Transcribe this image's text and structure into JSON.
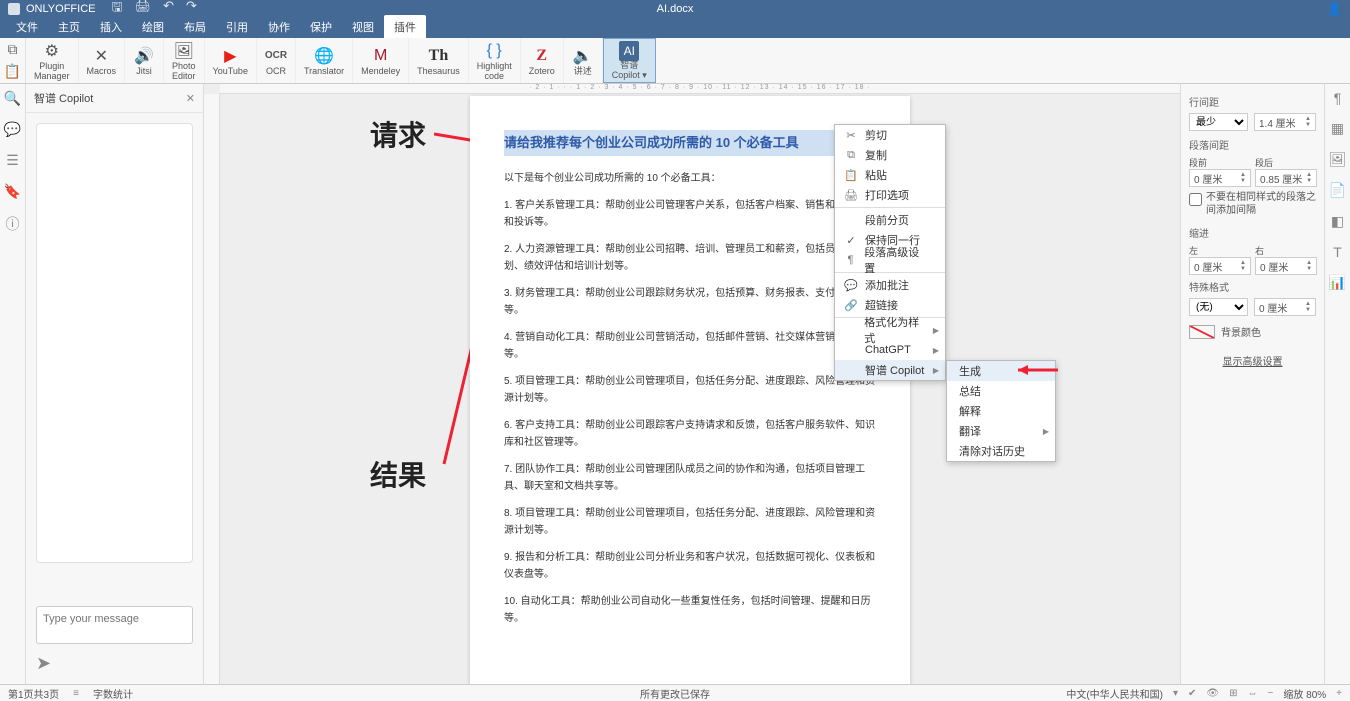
{
  "app": {
    "name": "ONLYOFFICE",
    "doc_name": "AI.docx"
  },
  "tabs": [
    "文件",
    "主页",
    "插入",
    "绘图",
    "布局",
    "引用",
    "协作",
    "保护",
    "视图",
    "插件"
  ],
  "active_tab_index": 9,
  "ribbon": [
    {
      "id": "plugin-manager",
      "label": "Plugin\nManager",
      "icon": "⚙"
    },
    {
      "id": "macros",
      "label": "Macros",
      "icon": "✕"
    },
    {
      "id": "jitsi",
      "label": "Jitsi",
      "icon": "🔊"
    },
    {
      "id": "photo-editor",
      "label": "Photo\nEditor",
      "icon": "🖼"
    },
    {
      "id": "youtube",
      "label": "YouTube",
      "icon": "▶",
      "cls": "youtube"
    },
    {
      "id": "ocr",
      "label": "OCR",
      "icon": "OCR",
      "cls": "ocr"
    },
    {
      "id": "translator",
      "label": "Translator",
      "icon": "🌐"
    },
    {
      "id": "mendeley",
      "label": "Mendeley",
      "icon": "M",
      "cls": "mendeley"
    },
    {
      "id": "thesaurus",
      "label": "Thesaurus",
      "icon": "Th",
      "cls": "thesaurus"
    },
    {
      "id": "highlight-code",
      "label": "Highlight\ncode",
      "icon": "{ }",
      "cls": "code"
    },
    {
      "id": "zotero",
      "label": "Zotero",
      "icon": "Z",
      "cls": "zotero"
    },
    {
      "id": "speech",
      "label": "讲述",
      "icon": "🔈"
    },
    {
      "id": "copilot",
      "label": "智谱\nCopilot ▾",
      "icon": "AI",
      "cls": "copilot",
      "highlighted": true
    }
  ],
  "side_panel": {
    "title": "智谱 Copilot",
    "input_placeholder": "Type your message"
  },
  "annotations": {
    "request": "请求",
    "result": "结果"
  },
  "document": {
    "request": "请给我推荐每个创业公司成功所需的 10 个必备工具",
    "intro": "以下是每个创业公司成功所需的 10 个必备工具：",
    "items": [
      "1. 客户关系管理工具：帮助创业公司管理客户关系，包括客户档案、销售和营销进度和投诉等。",
      "2. 人力资源管理工具：帮助创业公司招聘、培训、管理员工和薪资，包括员工档案计划、绩效评估和培训计划等。",
      "3. 财务管理工具：帮助创业公司跟踪财务状况，包括预算、财务报表、支付和收款等。",
      "4. 营销自动化工具：帮助创业公司营销活动，包括邮件营销、社交媒体营销、搜索告等。",
      "5. 项目管理工具：帮助创业公司管理项目，包括任务分配、进度跟踪、风险管理和资源计划等。",
      "6. 客户支持工具：帮助创业公司跟踪客户支持请求和反馈，包括客户服务软件、知识库和社区管理等。",
      "7. 团队协作工具：帮助创业公司管理团队成员之间的协作和沟通，包括项目管理工具、聊天室和文档共享等。",
      "8. 项目管理工具：帮助创业公司管理项目，包括任务分配、进度跟踪、风险管理和资源计划等。",
      "9. 报告和分析工具：帮助创业公司分析业务和客户状况，包括数据可视化、仪表板和仪表盘等。",
      "10. 自动化工具：帮助创业公司自动化一些重复性任务，包括时间管理、提醒和日历等。"
    ]
  },
  "context_menu": {
    "items": [
      {
        "icon": "✂",
        "label": "剪切"
      },
      {
        "icon": "⧉",
        "label": "复制"
      },
      {
        "icon": "📋",
        "label": "粘贴"
      },
      {
        "icon": "🖨",
        "label": "打印选项"
      },
      {
        "sep": true
      },
      {
        "icon": "",
        "label": "段前分页"
      },
      {
        "icon": "✓",
        "label": "保持同一行",
        "check": true
      },
      {
        "icon": "¶",
        "label": "段落高级设置"
      },
      {
        "sep": true
      },
      {
        "icon": "💬",
        "label": "添加批注"
      },
      {
        "icon": "🔗",
        "label": "超链接"
      },
      {
        "sep": true
      },
      {
        "icon": "",
        "label": "格式化为样式",
        "sub": true
      },
      {
        "icon": "",
        "label": "ChatGPT",
        "sub": true
      },
      {
        "icon": "",
        "label": "智谱 Copilot",
        "sub": true,
        "hovered": true
      }
    ],
    "sub_items": [
      {
        "label": "生成",
        "hovered": true
      },
      {
        "label": "总结"
      },
      {
        "label": "解释"
      },
      {
        "label": "翻译",
        "sub": true
      },
      {
        "label": "清除对话历史"
      }
    ]
  },
  "props": {
    "line_spacing_title": "行间距",
    "line_spacing_mode": "最少",
    "line_spacing_value": "1.4 厘米",
    "para_spacing_title": "段落间距",
    "before_label": "段前",
    "after_label": "段后",
    "before_value": "0 厘米",
    "after_value": "0.85 厘米",
    "same_style_cb": "不要在相同样式的段落之间添加间隔",
    "indent_title": "缩进",
    "indent_left_label": "左",
    "indent_right_label": "右",
    "indent_left_value": "0 厘米",
    "indent_right_value": "0 厘米",
    "special_title": "特殊格式",
    "special_mode": "(无)",
    "special_value": "0 厘米",
    "bg_color_label": "背景颜色",
    "advanced": "显示高级设置"
  },
  "status": {
    "pages": "第1页共3页",
    "wordcount": "字数统计",
    "save_state": "所有更改已保存",
    "language": "中文(中华人民共和国)",
    "zoom": "缩放 80%"
  },
  "ruler_h": "· 2 · 1 · · · 1 · 2 · 3 · 4 · 5 · 6 · 7 · 8 · 9 · 10 · 11 · 12 · 13 · 14 · 15 · 16 · 17 · 18 ·"
}
